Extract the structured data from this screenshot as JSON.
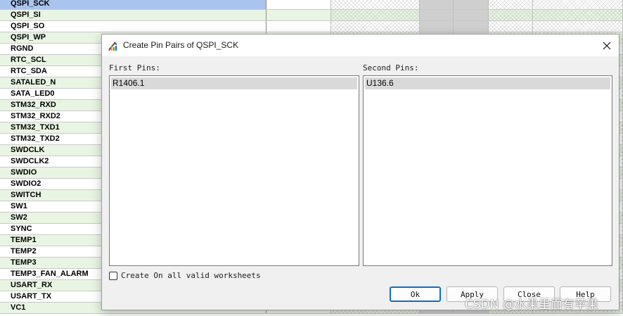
{
  "sheet": {
    "rows": [
      {
        "name": "QSPI_SCK",
        "selected": true
      },
      {
        "name": "QSPI_SI"
      },
      {
        "name": "QSPI_SO"
      },
      {
        "name": "QSPI_WP"
      },
      {
        "name": "RGND"
      },
      {
        "name": "RTC_SCL"
      },
      {
        "name": "RTC_SDA"
      },
      {
        "name": "SATALED_N"
      },
      {
        "name": "SATA_LED0"
      },
      {
        "name": "STM32_RXD"
      },
      {
        "name": "STM32_RXD2"
      },
      {
        "name": "STM32_TXD1"
      },
      {
        "name": "STM32_TXD2"
      },
      {
        "name": "SWDCLK"
      },
      {
        "name": "SWDCLK2"
      },
      {
        "name": "SWDIO"
      },
      {
        "name": "SWDIO2"
      },
      {
        "name": "SWITCH"
      },
      {
        "name": "SW1"
      },
      {
        "name": "SW2"
      },
      {
        "name": "SYNC"
      },
      {
        "name": "TEMP1"
      },
      {
        "name": "TEMP2"
      },
      {
        "name": "TEMP3"
      },
      {
        "name": "TEMP3_FAN_ALARM"
      },
      {
        "name": "USART_RX"
      },
      {
        "name": "USART_TX"
      },
      {
        "name": "VC1"
      }
    ]
  },
  "dialog": {
    "title": "Create Pin Pairs of QSPI_SCK",
    "close_icon": "close-icon",
    "first_label": "First Pins:",
    "second_label": "Second Pins:",
    "first_items": [
      "R1406.1"
    ],
    "second_items": [
      "U136.6"
    ],
    "checkbox_label": "Create On all valid worksheets",
    "checkbox_checked": false,
    "ok_label": "Ok",
    "apply_label": "Apply",
    "close_label": "Close",
    "help_label": "Help"
  },
  "watermark": "CSDN @水果里面有苹果",
  "colors": {
    "selected_row": "#a9c5ef",
    "green_row": "#e9f5e3",
    "default_button_border": "#0f6cbd"
  }
}
